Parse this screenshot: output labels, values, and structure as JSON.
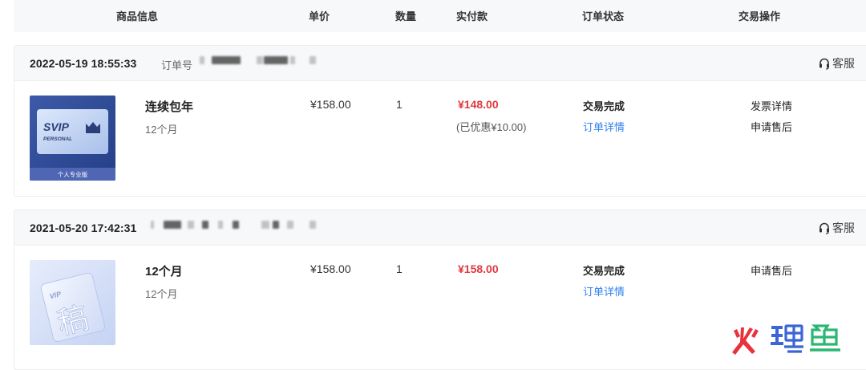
{
  "table_header": {
    "product": "商品信息",
    "unit_price": "单价",
    "quantity": "数量",
    "paid": "实付款",
    "status": "订单状态",
    "actions": "交易操作"
  },
  "orders": [
    {
      "date": "2022-05-19 18:55:33",
      "order_no_label": "订单号",
      "customer_service": "客服",
      "thumb": {
        "brand": "SVIP",
        "sub": "PERSONAL",
        "caption": "个人专业版"
      },
      "product_name": "连续包年",
      "spec": "12个月",
      "unit_price": "¥158.00",
      "quantity": "1",
      "paid": "¥148.00",
      "discount": "(已优惠¥10.00)",
      "status": "交易完成",
      "detail_link": "订单详情",
      "action_1": "发票详情",
      "action_2": "申请售后"
    },
    {
      "date": "2021-05-20 17:42:31",
      "customer_service": "客服",
      "thumb": {
        "brand": "VIP",
        "glyph": "稿"
      },
      "product_name": "12个月",
      "spec": "12个月",
      "unit_price": "¥158.00",
      "quantity": "1",
      "paid": "¥158.00",
      "status": "交易完成",
      "detail_link": "订单详情",
      "action_1": "申请售后"
    }
  ],
  "colors": {
    "price_red": "#e0393e",
    "link_blue": "#2f7ff0",
    "header_bg": "#f7f8fa",
    "watermark_red": "#e8323c"
  },
  "icons": {
    "customer_service": "headset-icon"
  }
}
